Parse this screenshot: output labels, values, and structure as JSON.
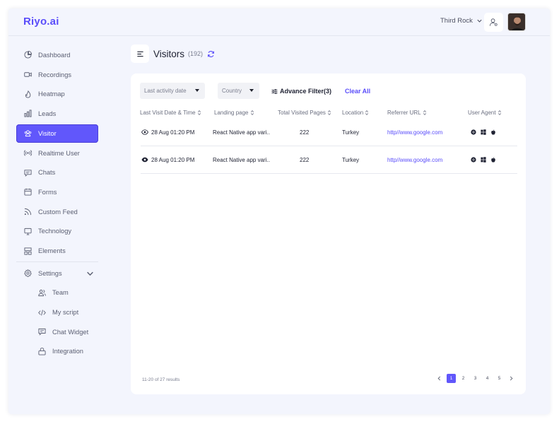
{
  "app": {
    "logo": "Riyo.ai"
  },
  "header": {
    "workspace": "Third Rock"
  },
  "sidebar": {
    "items": [
      {
        "label": "Dashboard",
        "icon": "pie-chart-icon"
      },
      {
        "label": "Recordings",
        "icon": "video-icon"
      },
      {
        "label": "Heatmap",
        "icon": "flame-icon"
      },
      {
        "label": "Leads",
        "icon": "bar-chart-icon"
      },
      {
        "label": "Visitor",
        "icon": "users-icon",
        "active": true
      },
      {
        "label": "Realtime User",
        "icon": "broadcast-icon"
      },
      {
        "label": "Chats",
        "icon": "chat-icon"
      },
      {
        "label": "Forms",
        "icon": "calendar-icon"
      },
      {
        "label": "Custom Feed",
        "icon": "rss-icon"
      },
      {
        "label": "Technology",
        "icon": "monitor-icon"
      },
      {
        "label": "Elements",
        "icon": "layout-icon"
      }
    ],
    "settings": {
      "label": "Settings",
      "icon": "gear-icon"
    },
    "sub_items": [
      {
        "label": "Team",
        "icon": "team-icon"
      },
      {
        "label": "My script",
        "icon": "code-icon"
      },
      {
        "label": "Chat Widget",
        "icon": "chat-widget-icon"
      },
      {
        "label": "Integration",
        "icon": "integration-icon"
      }
    ]
  },
  "page": {
    "title": "Visitors",
    "count": "(192)"
  },
  "filters": {
    "last_activity": "Last activity date",
    "country": "Country",
    "advance": "Advance Filter(3)",
    "clear": "Clear All"
  },
  "table": {
    "columns": [
      "Last Visit Date & Time",
      "Landing page",
      "Total Visited Pages",
      "Location",
      "Referrer URL",
      "User Agent"
    ],
    "rows": [
      {
        "date": "28 Aug 01:20 PM",
        "landing": "React Native app vari..",
        "pages": "222",
        "location": "Turkey",
        "referrer": "http//www.google.com"
      },
      {
        "date": "28 Aug 01:20 PM",
        "landing": "React Native app vari..",
        "pages": "222",
        "location": "Turkey",
        "referrer": "http//www.google.com"
      }
    ]
  },
  "pagination": {
    "results": "11-20 of 27 results",
    "pages": [
      "1",
      "2",
      "3",
      "4",
      "5"
    ],
    "active": "1"
  },
  "colors": {
    "accent": "#6157fb",
    "link": "#5a4dfa",
    "background": "#f3f5fd"
  }
}
